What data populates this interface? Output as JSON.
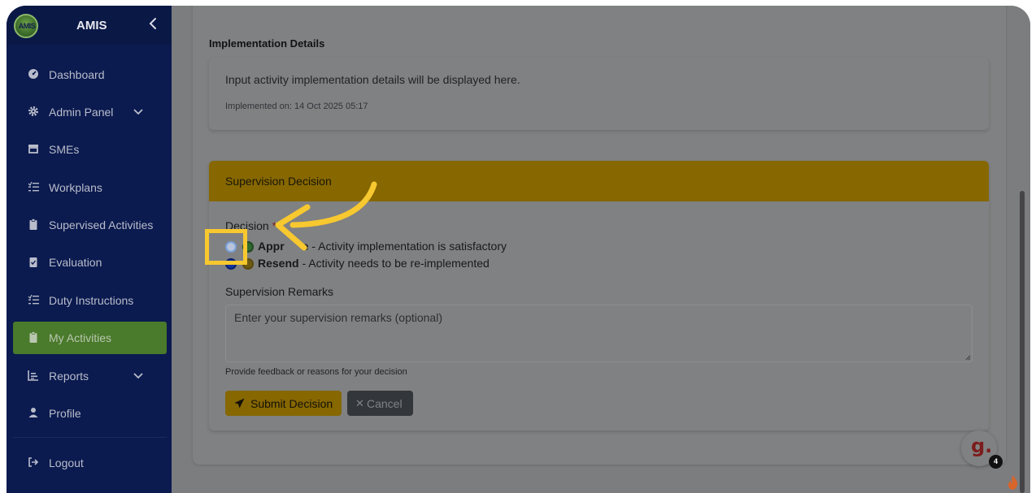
{
  "app": {
    "logo_text": "AMIS",
    "name": "AMIS"
  },
  "sidebar": {
    "items": [
      {
        "label": "Dashboard",
        "icon": "dashboard-icon"
      },
      {
        "label": "Admin Panel",
        "icon": "gear-icon",
        "has_chevron": true
      },
      {
        "label": "SMEs",
        "icon": "store-icon"
      },
      {
        "label": "Workplans",
        "icon": "list-icon"
      },
      {
        "label": "Supervised Activities",
        "icon": "clipboard-icon"
      },
      {
        "label": "Evaluation",
        "icon": "clipboard-check-icon"
      },
      {
        "label": "Duty Instructions",
        "icon": "list-icon"
      },
      {
        "label": "My Activities",
        "icon": "clipboard-icon",
        "active": true
      },
      {
        "label": "Reports",
        "icon": "chart-icon",
        "has_chevron": true
      },
      {
        "label": "Profile",
        "icon": "user-icon"
      },
      {
        "label": "Logout",
        "icon": "logout-icon"
      }
    ]
  },
  "implementation": {
    "title": "Implementation Details",
    "description": "Input activity implementation details will be displayed here.",
    "implemented_on": "Implemented on: 14 Oct 2025 05:17"
  },
  "supervision": {
    "title": "Supervision Decision",
    "decision_label": "Decision",
    "required_mark": "*",
    "options": [
      {
        "name": "Approve",
        "visible_name": "Appr",
        "visible_name_tail": "e",
        "description": " - Activity implementation is satisfactory"
      },
      {
        "name": "Resend",
        "description": " - Activity needs to be re-implemented"
      }
    ],
    "remarks_label": "Supervision Remarks",
    "remarks_placeholder": "Enter your supervision remarks (optional)",
    "help_text": "Provide feedback or reasons for your decision",
    "submit_label": "Submit Decision",
    "cancel_label": "Cancel"
  },
  "fab": {
    "label": "g.",
    "badge": "4"
  },
  "colors": {
    "sidebar": "#0b1a4f",
    "active_nav": "#4a7a2b",
    "header": "#866700",
    "highlight": "#f7c82f",
    "overlay": "#7c7d7f"
  }
}
